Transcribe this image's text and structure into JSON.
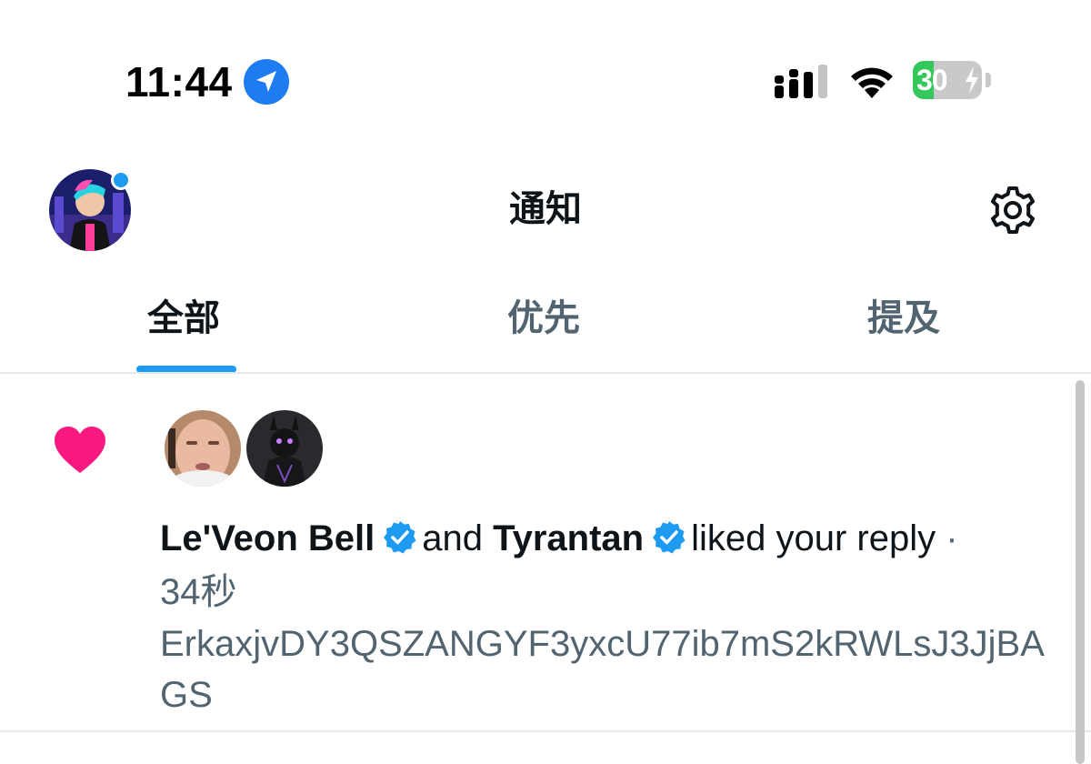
{
  "status_bar": {
    "time": "11:44",
    "battery": "30",
    "battery_level": 0.3
  },
  "header": {
    "title": "通知"
  },
  "tabs": [
    {
      "label": "全部",
      "active": true
    },
    {
      "label": "优先",
      "active": false
    },
    {
      "label": "提及",
      "active": false
    }
  ],
  "notification": {
    "type": "like",
    "user1": "Le'Veon Bell",
    "connector": "and",
    "user2": "Tyrantan",
    "action": "liked your reply",
    "separator": "·",
    "time": "34秒",
    "reply_text": "ErkaxjvDY3QSZANGYF3yxcU77ib7mS2kRWLsJ3JjBAGS"
  },
  "colors": {
    "accent": "#1d9bf0",
    "like": "#f91880",
    "text_primary": "#0f1419",
    "text_secondary": "#536471",
    "battery_fill": "#34c759"
  },
  "icons": [
    "location-arrow-icon",
    "signal-icon",
    "wifi-icon",
    "battery-icon",
    "gear-icon",
    "heart-icon",
    "verified-badge-icon"
  ]
}
